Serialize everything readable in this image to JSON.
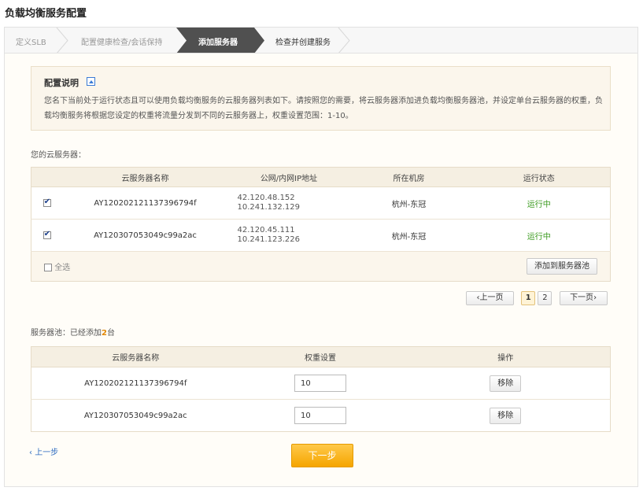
{
  "page_title": "负载均衡服务配置",
  "steps": [
    {
      "label": "定义SLB",
      "state": "done"
    },
    {
      "label": "配置健康检查/会话保持",
      "state": "done"
    },
    {
      "label": "添加服务器",
      "state": "active"
    },
    {
      "label": "检查并创建服务",
      "state": "todo"
    }
  ],
  "config_note": {
    "title": "配置说明",
    "text": "您名下当前处于运行状态且可以使用负载均衡服务的云服务器列表如下。请按照您的需要，将云服务器添加进负载均衡服务器池，并设定单台云服务器的权重，负载均衡服务将根据您设定的权重将流量分发到不同的云服务器上，权重设置范围：1-10。"
  },
  "ecs_section": {
    "label": "您的云服务器：",
    "columns": [
      "云服务器名称",
      "公网/内网IP地址",
      "所在机房",
      "运行状态"
    ],
    "rows": [
      {
        "name": "AY120202121137396794f",
        "public_ip": "42.120.48.152",
        "private_ip": "10.241.132.129",
        "zone": "杭州-东冠",
        "status": "运行中",
        "checked": true
      },
      {
        "name": "AY120307053049c99a2ac",
        "public_ip": "42.120.45.111",
        "private_ip": "10.241.123.226",
        "zone": "杭州-东冠",
        "status": "运行中",
        "checked": true
      }
    ],
    "select_all_label": "全选",
    "add_button": "添加到服务器池"
  },
  "pagination": {
    "prev": "上一页",
    "pages": [
      "1",
      "2"
    ],
    "current": "1",
    "next": "下一页"
  },
  "pool_section": {
    "label_prefix": "服务器池：已经添加",
    "count": "2",
    "label_suffix": "台",
    "columns": [
      "云服务器名称",
      "权重设置",
      "操作"
    ],
    "rows": [
      {
        "name": "AY120202121137396794f",
        "weight": "10",
        "action": "移除"
      },
      {
        "name": "AY120307053049c99a2ac",
        "weight": "10",
        "action": "移除"
      }
    ]
  },
  "footer": {
    "prev_step": "上一步",
    "next_step": "下一步"
  },
  "colors": {
    "active_step": "#4d4d4d",
    "status_running": "#3a9a1e",
    "next_button": "#f5a500",
    "link": "#2e6cc0"
  }
}
